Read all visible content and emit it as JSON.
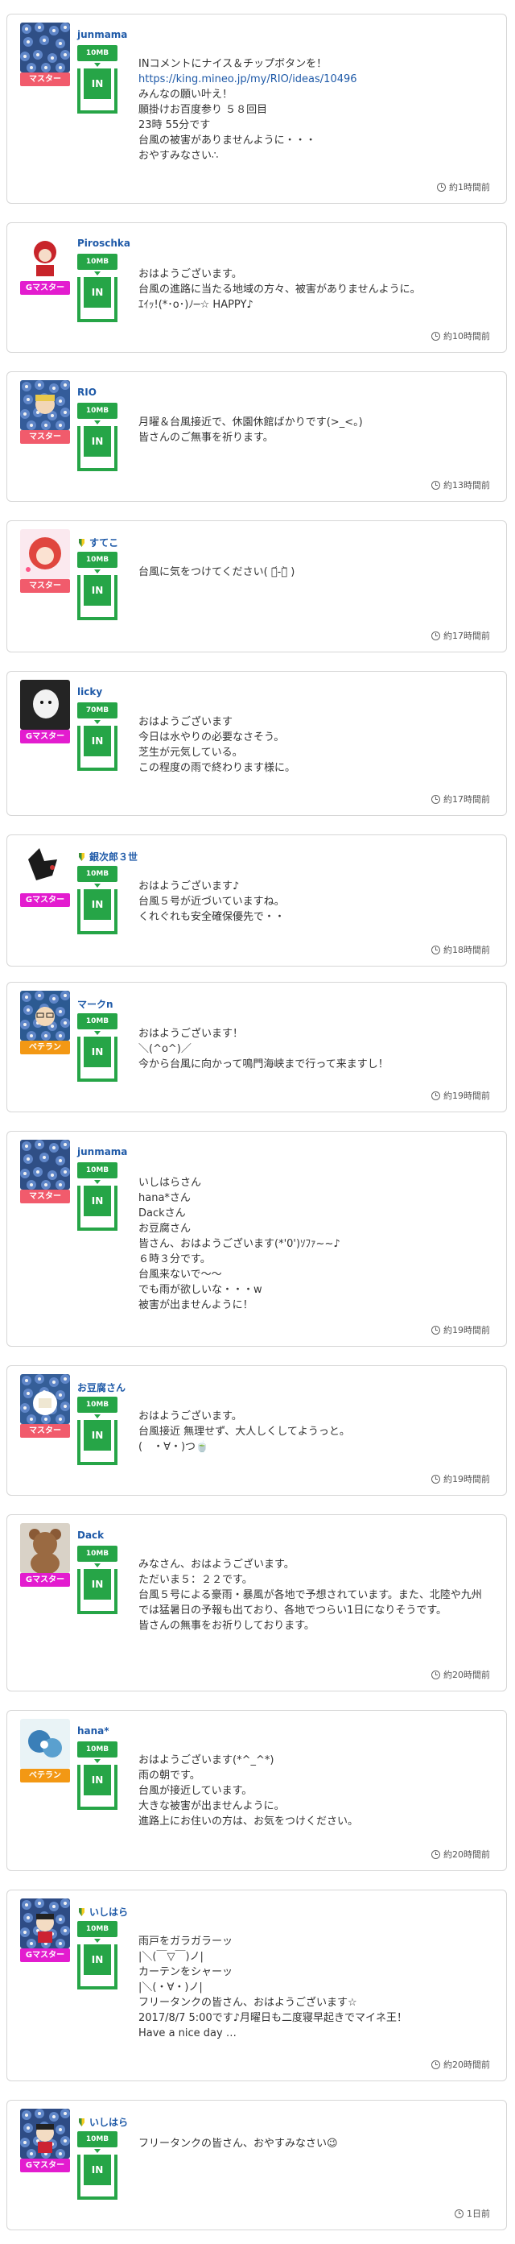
{
  "labels": {
    "in_button": "IN"
  },
  "posts": [
    {
      "username": "junmama",
      "leaf": false,
      "badge": "マスター",
      "badge_type": "master",
      "tip": "10MB",
      "time": "約1時間前",
      "avatar": "blue-flowers",
      "message": [
        "INコメントにナイス＆チップボタンを！",
        "https://king.mineo.jp/my/RIO/ideas/10496",
        "みんなの願い叶え！",
        "願掛けお百度参り ５８回目",
        "23時 55分です",
        "台風の被害がありませんように・・・",
        "おやすみなさい∴"
      ]
    },
    {
      "username": "Piroschka",
      "leaf": false,
      "badge": "Gマスター",
      "badge_type": "gmaster",
      "tip": "10MB",
      "time": "約10時間前",
      "avatar": "red-doll",
      "message": [
        "おはようございます。",
        "台風の進路に当たる地域の方々、被害がありませんように。",
        "ｴｲｯ!(*･o･)ﾉ─☆ HAPPY♪"
      ]
    },
    {
      "username": "RIO",
      "leaf": false,
      "badge": "マスター",
      "badge_type": "master",
      "tip": "10MB",
      "time": "約13時間前",
      "avatar": "anime-flowers",
      "message": [
        "月曜＆台風接近で、休園休館ばかりです(>_<。)",
        "皆さんのご無事を祈ります。"
      ]
    },
    {
      "username": "すてこ",
      "leaf": true,
      "badge": "マスター",
      "badge_type": "master",
      "tip": "10MB",
      "time": "約17時間前",
      "avatar": "red-hair",
      "message": [
        "台風に気をつけてください( ･᷄-･᷅ )"
      ]
    },
    {
      "username": "licky",
      "leaf": false,
      "badge": "Gマスター",
      "badge_type": "gmaster",
      "tip": "70MB",
      "time": "約17時間前",
      "avatar": "white-dog",
      "message": [
        "おはようございます",
        "今日は水やりの必要なさそう。",
        "芝生が元気している。",
        "この程度の雨で終わります様に。"
      ]
    },
    {
      "username": "銀次郎３世",
      "leaf": true,
      "badge": "Gマスター",
      "badge_type": "gmaster",
      "tip": "10MB",
      "time": "約18時間前",
      "avatar": "black-dog",
      "message": [
        "おはようございます♪",
        "台風５号が近づいていますね。",
        "くれぐれも安全確保優先で・・"
      ]
    },
    {
      "username": "マークn",
      "leaf": false,
      "badge": "ベテラン",
      "badge_type": "veteran",
      "tip": "10MB",
      "time": "約19時間前",
      "avatar": "glasses-man",
      "message": [
        "おはようございます！",
        "＼(^o^)／",
        "今から台風に向かって鳴門海峡まで行って来ますし！"
      ]
    },
    {
      "username": "junmama",
      "leaf": false,
      "badge": "マスター",
      "badge_type": "master",
      "tip": "10MB",
      "time": "約19時間前",
      "avatar": "blue-flowers",
      "message": [
        "いしはらさん",
        "hana*さん",
        "Dackさん",
        "お豆腐さん",
        "皆さん、おはようございます(*'0')ｿﾌｧ~~♪",
        "６時３分です。",
        "台風来ないで〜〜",
        "でも雨が欲しいな・・・w",
        "被害が出ませんように！"
      ]
    },
    {
      "username": "お豆腐さん",
      "leaf": false,
      "badge": "マスター",
      "badge_type": "master",
      "tip": "10MB",
      "time": "約19時間前",
      "avatar": "tofu",
      "message": [
        "おはようございます。",
        "台風接近 無理せず、大人しくしてようっと。",
        "(　・∀・)つ🍵"
      ]
    },
    {
      "username": "Dack",
      "leaf": false,
      "badge": "Gマスター",
      "badge_type": "gmaster",
      "tip": "10MB",
      "time": "約20時間前",
      "avatar": "teddy-bear",
      "message": [
        "みなさん、おはようございます。",
        "ただいま５：２２です。",
        "台風５号による豪雨・暴風が各地で予想されています。また、北陸や九州では猛暑日の予報も出ており、各地でつらい1日になりそうです。",
        "皆さんの無事をお祈りしております。"
      ]
    },
    {
      "username": "hana*",
      "leaf": false,
      "badge": "ベテラン",
      "badge_type": "veteran",
      "tip": "10MB",
      "time": "約20時間前",
      "avatar": "blue-bloom",
      "message": [
        "おはようございます(*^_^*)",
        "雨の朝です。",
        "台風が接近しています。",
        "大きな被害が出ませんように。",
        "進路上にお住いの方は、お気をつけください。"
      ]
    },
    {
      "username": "いしはら",
      "leaf": true,
      "badge": "Gマスター",
      "badge_type": "gmaster",
      "tip": "10MB",
      "time": "約20時間前",
      "avatar": "anime-blue",
      "message": [
        "雨戸をガラガラーッ",
        "|＼(￣▽￣)ノ|",
        "カーテンをシャーッ",
        "|＼(・∀・)ノ|",
        "フリータンクの皆さん、おはようございます☆",
        "2017/8/7 5:00です♪月曜日も二度寝早起きでマイネ王！",
        "Have a nice day …"
      ]
    },
    {
      "username": "いしはら",
      "leaf": true,
      "badge": "Gマスター",
      "badge_type": "gmaster",
      "tip": "10MB",
      "time": "1日前",
      "avatar": "anime-blue",
      "message": [
        "フリータンクの皆さん、おやすみなさい😉"
      ]
    }
  ]
}
